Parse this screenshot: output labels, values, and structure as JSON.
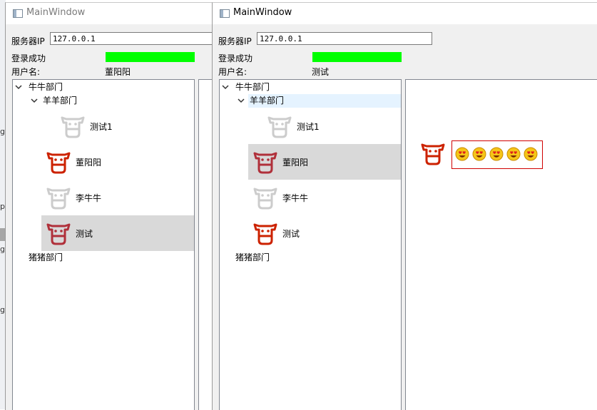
{
  "windows": [
    {
      "title": "MainWindow",
      "server_ip_label": "服务器IP",
      "server_ip_value": "127.0.0.1",
      "login_status": "登录成功",
      "status_color": "#00ff00",
      "username_label": "用户名:",
      "username_value": "董阳阳",
      "tree": {
        "root": "牛牛部门",
        "sub": "羊羊部门",
        "users": [
          {
            "name": "测试1",
            "status": "offline"
          },
          {
            "name": "董阳阳",
            "status": "online"
          },
          {
            "name": "李牛牛",
            "status": "offline"
          },
          {
            "name": "测试",
            "status": "online",
            "selected": true
          }
        ],
        "other": "猪猪部门"
      }
    },
    {
      "title": "MainWindow",
      "server_ip_label": "服务器IP",
      "server_ip_value": "127.0.0.1",
      "login_status": "登录成功",
      "status_color": "#00ff00",
      "username_label": "用户名:",
      "username_value": "测试",
      "tree": {
        "root": "牛牛部门",
        "sub": "羊羊部门",
        "users": [
          {
            "name": "测试1",
            "status": "offline"
          },
          {
            "name": "董阳阳",
            "status": "online",
            "selected": true
          },
          {
            "name": "李牛牛",
            "status": "offline"
          },
          {
            "name": "测试",
            "status": "online"
          }
        ],
        "other": "猪猪部门"
      },
      "message": {
        "sender_status": "online",
        "emoji_icon": "heart-eyes-emoji",
        "emoji_count": 5
      }
    }
  ],
  "background_letters": [
    "g",
    "p",
    "g",
    "g"
  ],
  "colors": {
    "online_cow": "#cc2200",
    "offline_cow": "#cccccc",
    "selected_row": "#d9d9d9",
    "hover_row": "#e5f3ff",
    "message_border": "#d00000"
  }
}
